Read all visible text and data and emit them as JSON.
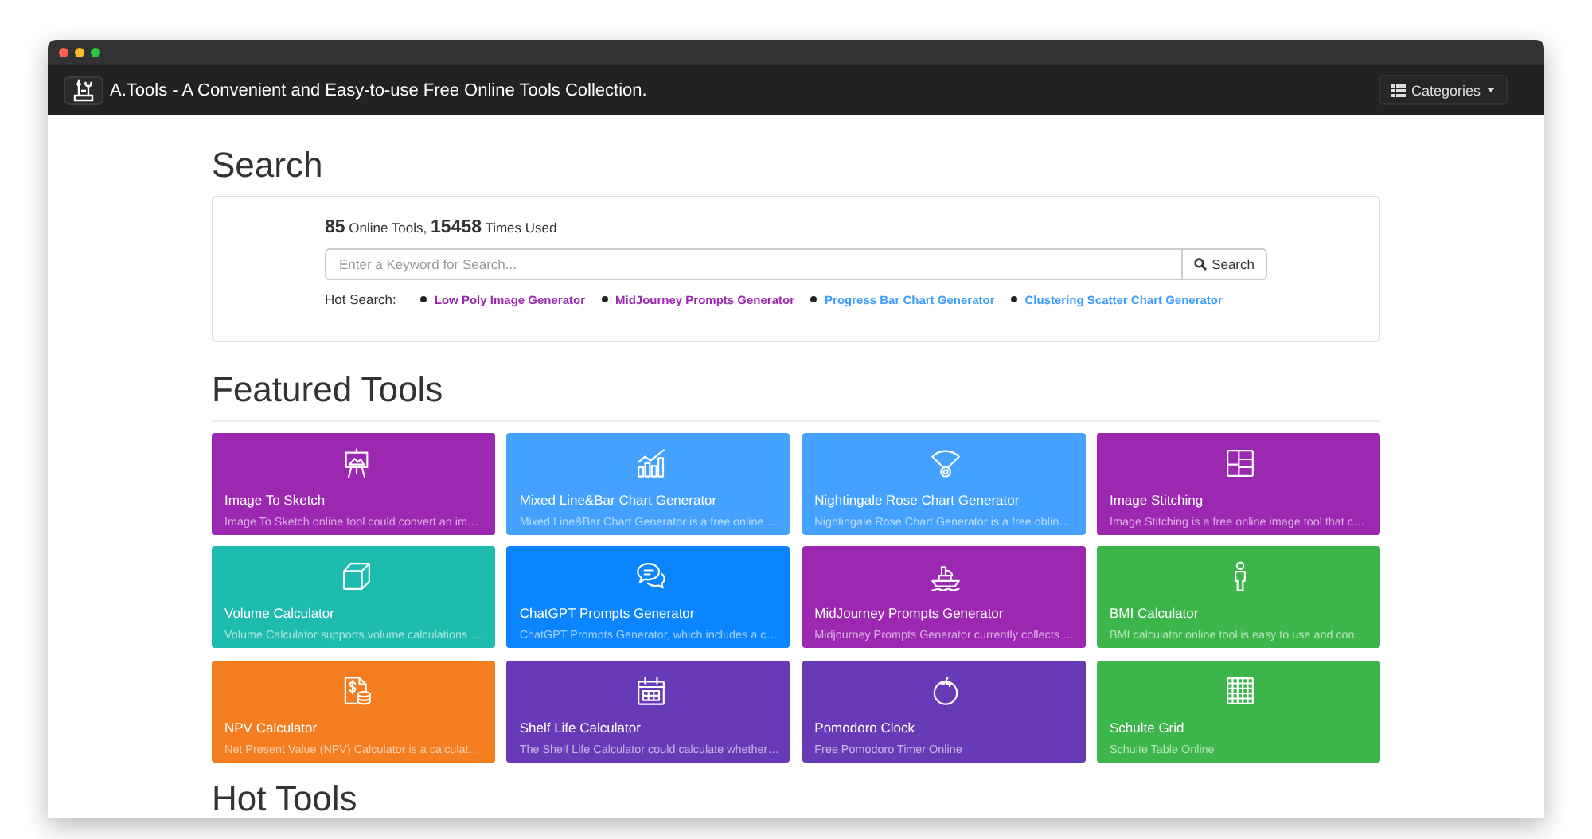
{
  "navbar": {
    "title": "A.Tools - A Convenient and Easy-to-use Free Online Tools Collection.",
    "categories_button": "Categories"
  },
  "search": {
    "heading": "Search",
    "stats": "**85** Online Tools, **15458** Times Used",
    "placeholder": "Enter a Keyword for Search...",
    "button": "Search",
    "hot_search_label": "Hot Search:",
    "hot_searches": [
      {
        "label": "Low Poly Image Generator",
        "color": "#9c27b0"
      },
      {
        "label": "MidJourney Prompts Generator",
        "color": "#9c27b0"
      },
      {
        "label": "Progress Bar Chart Generator",
        "color": "#3f9cff"
      },
      {
        "label": "Clustering Scatter Chart Generator",
        "color": "#3f9cff"
      }
    ]
  },
  "featured": {
    "heading": "Featured Tools",
    "tools": [
      {
        "title": "Image To Sketch",
        "description": "Image To Sketch online tool could convert an im…",
        "color": "#9c27b0"
      },
      {
        "title": "Mixed Line&Bar Chart Generator",
        "description": "Mixed Line&Bar Chart Generator is a free online …",
        "color": "#44a1ff"
      },
      {
        "title": "Nightingale Rose Chart Generator",
        "description": "Nightingale Rose Chart Generator is a free oblin…",
        "color": "#44a1ff"
      },
      {
        "title": "Image Stitching",
        "description": "Image Stitching is a free online image tool that c…",
        "color": "#9c27b0"
      },
      {
        "title": "Volume Calculator",
        "description": "Volume Calculator supports volume calculations …",
        "color": "#1ebcae"
      },
      {
        "title": "ChatGPT Prompts Generator",
        "description": "ChatGPT Prompts Generator, which includes a c…",
        "color": "#0a84ff"
      },
      {
        "title": "MidJourney Prompts Generator",
        "description": "Midjourney Prompts Generator currently collects …",
        "color": "#9c27b0"
      },
      {
        "title": "BMI Calculator",
        "description": "BMI calculator online tool is easy to use and con…",
        "color": "#3cb54a"
      },
      {
        "title": "NPV Calculator",
        "description": "Net Present Value (NPV) Calculator is a calculat…",
        "color": "#f47d20"
      },
      {
        "title": "Shelf Life Calculator",
        "description": "The Shelf Life Calculator could calculate whether…",
        "color": "#673ab7"
      },
      {
        "title": "Pomodoro Clock",
        "description": "Free Pomodoro Timer Online",
        "color": "#673ab7"
      },
      {
        "title": "Schulte Grid",
        "description": "Schulte Table Online",
        "color": "#3cb54a"
      }
    ]
  },
  "hot_tools": {
    "heading": "Hot Tools"
  }
}
